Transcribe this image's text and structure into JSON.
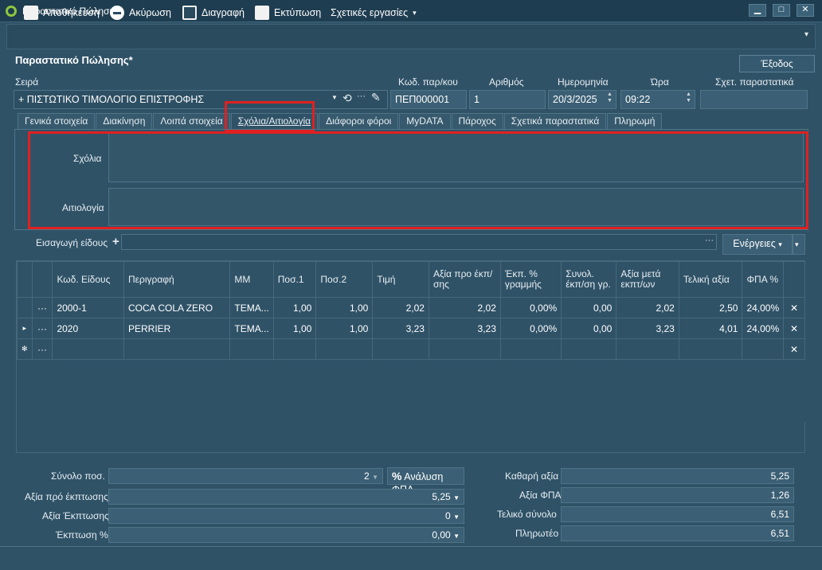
{
  "window": {
    "title": "Παραστατικό Πώλησης*",
    "minimize": "▁",
    "maximize": "□",
    "close": "✕"
  },
  "toolbar": {
    "save": "Αποθήκευση",
    "cancel": "Ακύρωση",
    "delete": "Διαγραφή",
    "print": "Εκτύπωση",
    "related": "Σχετικές εργασίες",
    "related_caret": "▾",
    "overflow": "▾"
  },
  "form": {
    "title": "Παραστατικό Πώλησης*",
    "exit": "Έξοδος"
  },
  "header": {
    "series_label": "Σειρά",
    "series_value": "+  ΠΙΣΤΩΤΙΚΟ ΤΙΜΟΛΟΓΙΟ ΕΠΙΣΤΡΟΦΗΣ",
    "code_label": "Κωδ. παρ/κου",
    "code_value": "ΠΕΠ000001",
    "number_label": "Αριθμός",
    "number_value": "1",
    "date_label": "Ημερομηνία",
    "date_value": "20/3/2025",
    "time_label": "Ώρα",
    "time_value": "09:22",
    "related_label": "Σχετ. παραστατικά",
    "related_value": ""
  },
  "tabs": [
    "Γενικά στοιχεία",
    "Διακίνηση",
    "Λοιπά στοιχεία",
    "Σχόλια/Αιτιολογία",
    "Διάφοροι φόροι",
    "MyDATA",
    "Πάροχος",
    "Σχετικά παραστατικά",
    "Πληρωμή"
  ],
  "notes": {
    "comments_label": "Σχόλια",
    "comments_value": "",
    "reason_label": "Αιτιολογία",
    "reason_value": ""
  },
  "items_bar": {
    "insert_label": "Εισαγωγή είδους",
    "plus": "+",
    "dots": "···",
    "actions": "Ενέργειες",
    "caret": "▾"
  },
  "grid": {
    "headers": [
      "Κωδ. Είδους",
      "Περιγραφή",
      "ΜΜ",
      "Ποσ.1",
      "Ποσ.2",
      "Τιμή",
      "Αξία προ έκπ/σης",
      "Έκπ. % γραμμής",
      "Συνολ. έκπ/ση γρ.",
      "Αξία μετά εκπτ/ων",
      "Τελική αξία",
      "ΦΠΑ %"
    ],
    "rows": [
      {
        "marker": "",
        "dots": "···",
        "cells": [
          "2000-1",
          "COCA COLA ZERO",
          "ΤΕΜΑ...",
          "1,00",
          "1,00",
          "2,02",
          "2,02",
          "0,00%",
          "0,00",
          "2,02",
          "2,50",
          "24,00%"
        ],
        "del": "✕"
      },
      {
        "marker": "▸",
        "dots": "···",
        "cells": [
          "2020",
          "PERRIER",
          "ΤΕΜΑ...",
          "1,00",
          "1,00",
          "3,23",
          "3,23",
          "0,00%",
          "0,00",
          "3,23",
          "4,01",
          "24,00%"
        ],
        "del": "✕"
      },
      {
        "marker": "✻",
        "dots": "···",
        "cells": [
          "",
          "",
          "",
          "",
          "",
          "",
          "",
          "",
          "",
          "",
          "",
          ""
        ],
        "del": "✕"
      }
    ]
  },
  "totals": {
    "qty_label": "Σύνολο ποσ.",
    "qty_value": "2",
    "vat_analysis": "Ανάλυση ΦΠΑ",
    "vat_analysis_icon": "%",
    "pre_disc_label": "Αξία πρό έκπτωσης",
    "pre_disc_value": "5,25",
    "disc_value_label": "Αξία Έκπτωσης",
    "disc_value": "0",
    "disc_pct_label": "Έκπτωση %",
    "disc_pct_value": "0,00",
    "net_label": "Καθαρή αξία",
    "net_value": "5,25",
    "vat_label": "Αξία ΦΠΑ",
    "vat_value": "1,26",
    "total_label": "Τελικό σύνολο",
    "total_value": "6,51",
    "payable_label": "Πληρωτέο",
    "payable_value": "6,51"
  }
}
